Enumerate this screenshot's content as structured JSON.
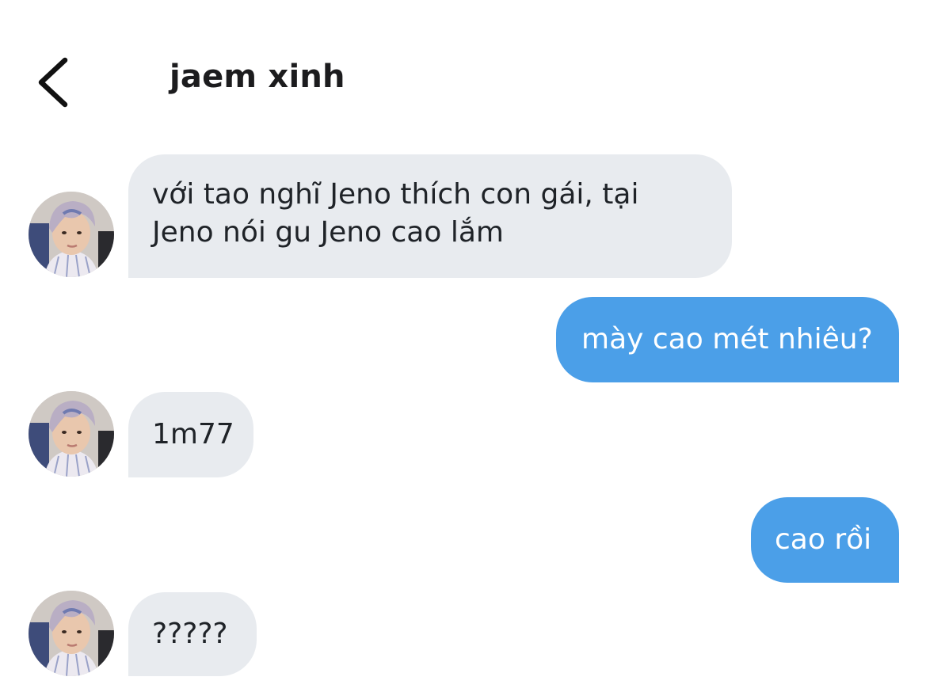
{
  "header": {
    "title": "jaem xinh",
    "back_icon": "chevron-left-icon"
  },
  "messages": [
    {
      "direction": "incoming",
      "text_lines": [
        "với tao nghĩ Jeno thích con gái, tại",
        "Jeno nói gu Jeno cao lắm"
      ]
    },
    {
      "direction": "outgoing",
      "text": "mày cao mét nhiêu?"
    },
    {
      "direction": "incoming",
      "text": "1m77"
    },
    {
      "direction": "outgoing",
      "text": "cao rồi"
    },
    {
      "direction": "incoming",
      "text": "?????"
    }
  ],
  "colors": {
    "incoming_bubble": "#e8ebef",
    "outgoing_bubble": "#4b9fe8",
    "incoming_text": "#1f2328",
    "outgoing_text": "#ffffff"
  }
}
